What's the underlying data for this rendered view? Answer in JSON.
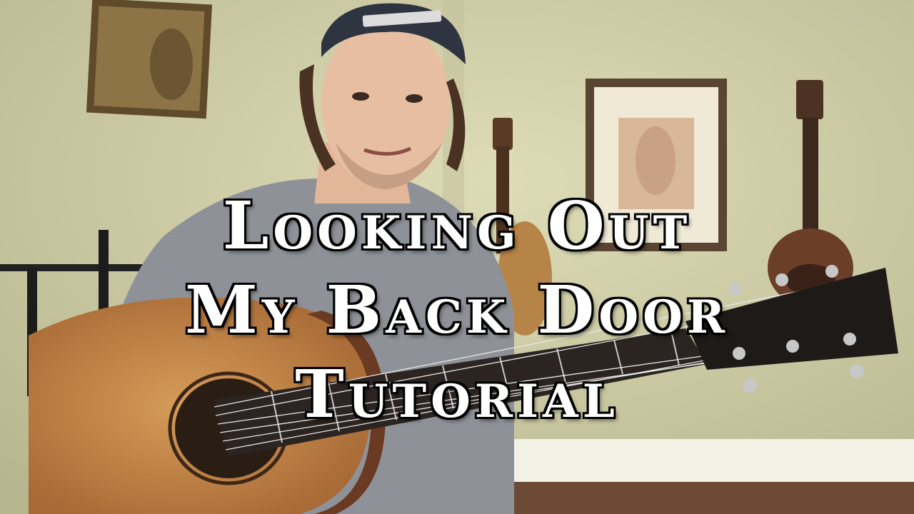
{
  "title": {
    "line1": "Looking Out",
    "line2": "My Back Door",
    "line3": "Tutorial"
  },
  "colors": {
    "wall": "#cfcfa6",
    "shirt": "#8e9298",
    "guitar_top": "#c98c4c",
    "cap": "#2e3440",
    "title_fill": "#ffffff",
    "title_stroke": "#000000"
  }
}
